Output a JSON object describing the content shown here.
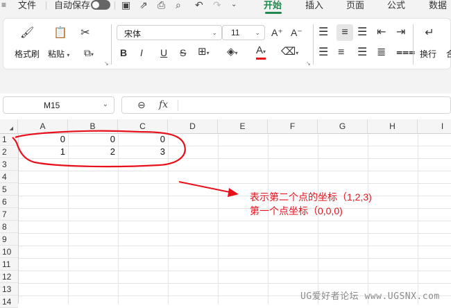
{
  "menubar": {
    "file": "文件",
    "autosave": "自动保存",
    "tabs": [
      "开始",
      "插入",
      "页面",
      "公式",
      "数据"
    ],
    "active_tab": "开始"
  },
  "ribbon": {
    "format_painter": "格式刷",
    "paste": "粘贴",
    "font_name": "宋体",
    "font_size": "11",
    "wrap": "换行",
    "truncated": "合",
    "bold": "B",
    "italic": "I",
    "underline": "U",
    "strike": "S",
    "font_color_letter": "A",
    "grow_font": "A⁺",
    "shrink_font": "A⁻"
  },
  "formula_bar": {
    "name_box": "M15",
    "fx": "fx"
  },
  "sheet": {
    "columns": [
      "A",
      "B",
      "C",
      "D",
      "E",
      "F",
      "G",
      "H",
      "I"
    ],
    "rows": [
      "1",
      "2",
      "3",
      "4",
      "5",
      "6",
      "7",
      "8",
      "9",
      "10",
      "11",
      "12",
      "13",
      "14"
    ],
    "cells": [
      [
        "0",
        "0",
        "0"
      ],
      [
        "1",
        "2",
        "3"
      ]
    ]
  },
  "annotation": {
    "line1": "表示第二个点的坐标（1,2,3)",
    "line2": "第一个点坐标（0,0,0)",
    "color": "#e8101a"
  },
  "watermark": "UG爱好者论坛 www.UGSNX.com",
  "colors": {
    "accent": "#1f8a4c",
    "annotation_red": "#e8101a"
  }
}
